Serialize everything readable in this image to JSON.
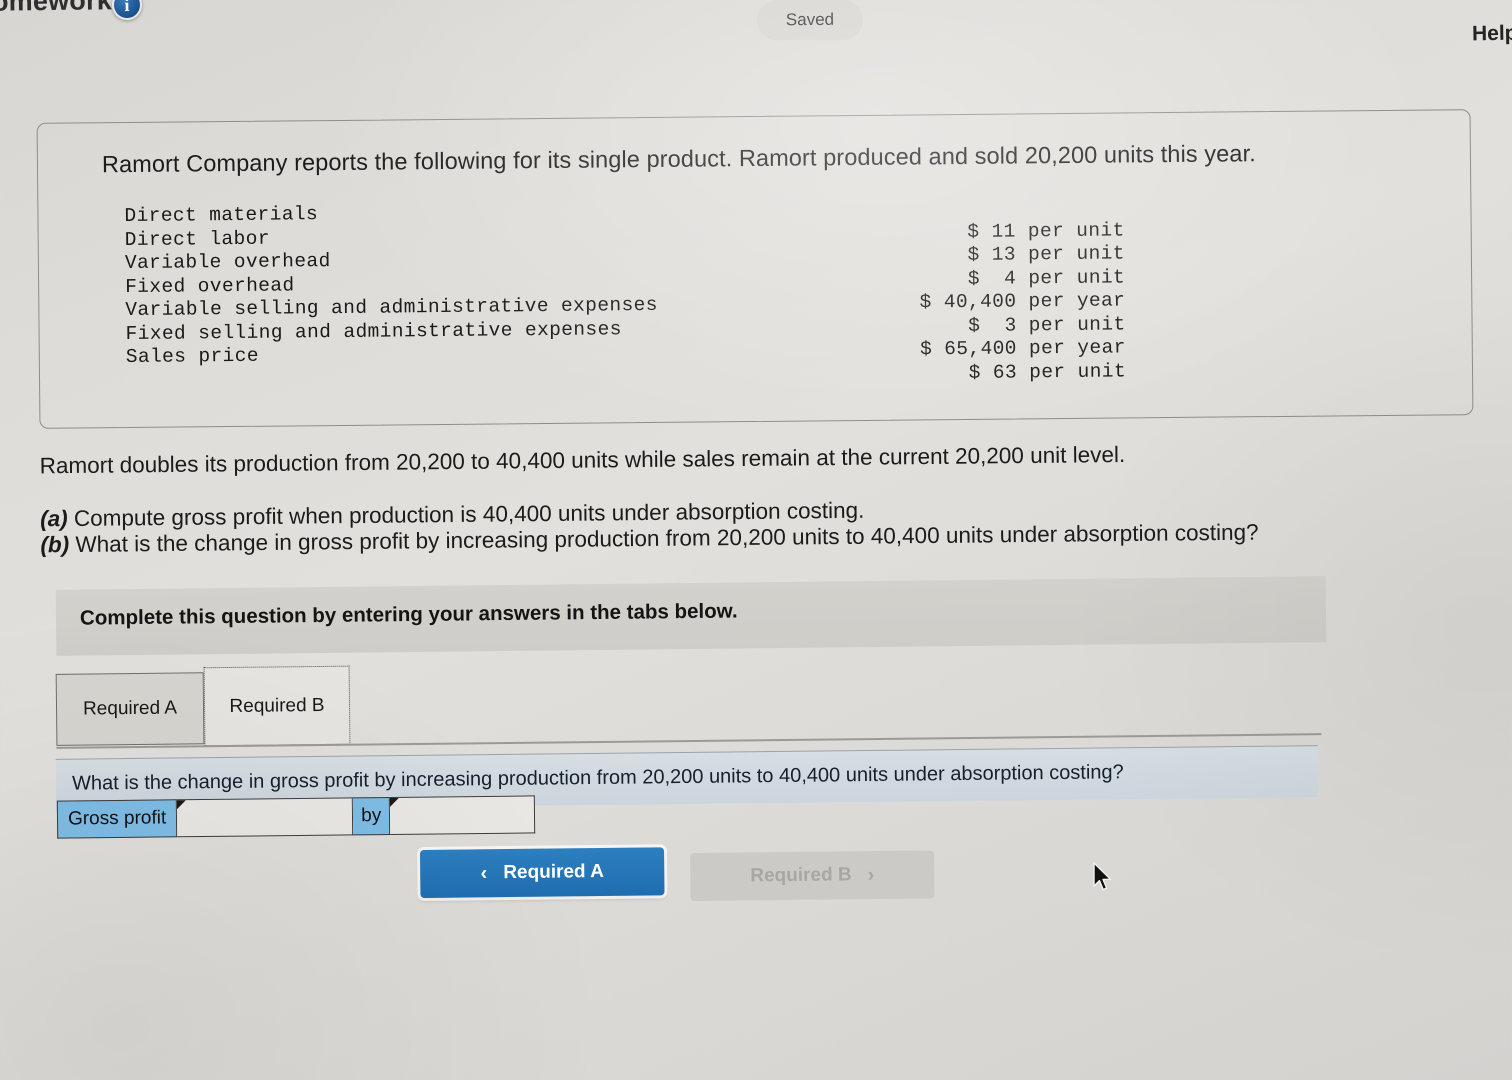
{
  "topbar": {
    "assignment_title": "omework",
    "info_badge": "i",
    "saved_status": "Saved",
    "help_label": "Help"
  },
  "fact_box": {
    "intro": "Ramort Company reports the following for its single product. Ramort produced and sold 20,200 units this year.",
    "rows": [
      {
        "label": "Direct materials",
        "value": "$ 11 per unit"
      },
      {
        "label": "Direct labor",
        "value": "$ 13 per unit"
      },
      {
        "label": "Variable overhead",
        "value": "$  4 per unit"
      },
      {
        "label": "Fixed overhead",
        "value": "$ 40,400 per year"
      },
      {
        "label": "Variable selling and administrative expenses",
        "value": "$  3 per unit"
      },
      {
        "label": "Fixed selling and administrative expenses",
        "value": "$ 65,400 per year"
      },
      {
        "label": "Sales price",
        "value": "$ 63 per unit"
      }
    ]
  },
  "prose": {
    "scenario": "Ramort doubles its production from 20,200 to 40,400 units while sales remain at the current 20,200 unit level.",
    "part_a_label": "(a)",
    "part_a_text": " Compute gross profit when production is 40,400 units under absorption costing.",
    "part_b_label": "(b)",
    "part_b_text": " What is the change in gross profit by increasing production from 20,200 units to 40,400 units under absorption costing?"
  },
  "banner": {
    "instruction": "Complete this question by entering your answers in the tabs below."
  },
  "tabs": [
    {
      "label": "Required A",
      "active": false
    },
    {
      "label": "Required B",
      "active": true
    }
  ],
  "question_row": {
    "text": "What is the change in gross profit by increasing production from 20,200 units to 40,400 units under absorption costing?"
  },
  "answer_row": {
    "label": "Gross profit",
    "value_1": "",
    "value_1_placeholder": "",
    "connector": "by",
    "value_2": "",
    "value_2_placeholder": ""
  },
  "nav": {
    "prev_chevron": "‹",
    "prev_label": "Required A",
    "next_label": "Required B",
    "next_chevron": "›"
  },
  "colors": {
    "accent_blue": "#1f6db0",
    "label_blue": "#7ebce4",
    "banner_gray": "#d3d1cc",
    "question_row_blue": "#d1d9e1",
    "badge_blue": "#1f5694",
    "page_bg": "#dedcd8"
  }
}
